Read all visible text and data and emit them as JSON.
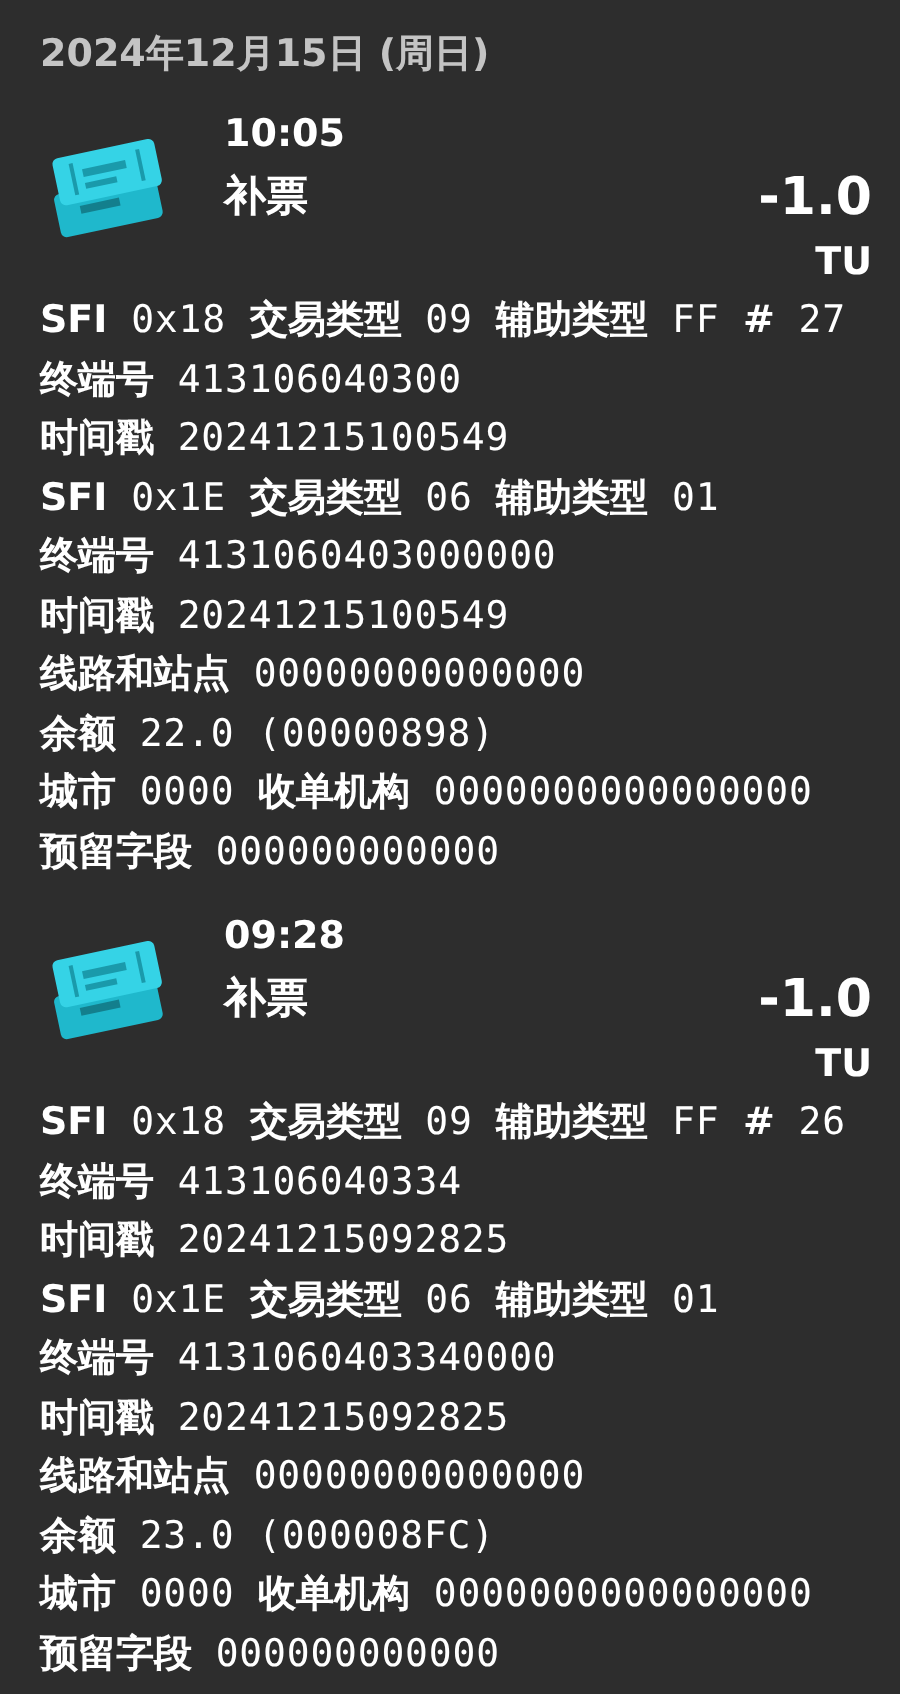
{
  "date": "2024年12月15日 (周日)",
  "entries": [
    {
      "time": "10:05",
      "title": "补票",
      "amount": "-1.0",
      "unit": "TU",
      "lines": [
        "**SFI** 0x18 **交易类型** 09 **辅助类型** FF **#** 27",
        "**终端号** 413106040300",
        "**时间戳** 20241215100549",
        "**SFI** 0x1E **交易类型** 06 **辅助类型** 01",
        "**终端号** 4131060403000000",
        "**时间戳** 20241215100549",
        "**线路和站点** 00000000000000",
        "**余额** 22.0 (00000898)",
        "**城市** 0000 **收单机构** 0000000000000000",
        "**预留字段** 000000000000"
      ]
    },
    {
      "time": "09:28",
      "title": "补票",
      "amount": "-1.0",
      "unit": "TU",
      "lines": [
        "**SFI** 0x18 **交易类型** 09 **辅助类型** FF **#** 26",
        "**终端号** 413106040334",
        "**时间戳** 20241215092825",
        "**SFI** 0x1E **交易类型** 06 **辅助类型** 01",
        "**终端号** 4131060403340000",
        "**时间戳** 20241215092825",
        "**线路和站点** 00000000000000",
        "**余额** 23.0 (000008FC)",
        "**城市** 0000 **收单机构** 0000000000000000",
        "**预留字段** 000000000000"
      ]
    }
  ]
}
